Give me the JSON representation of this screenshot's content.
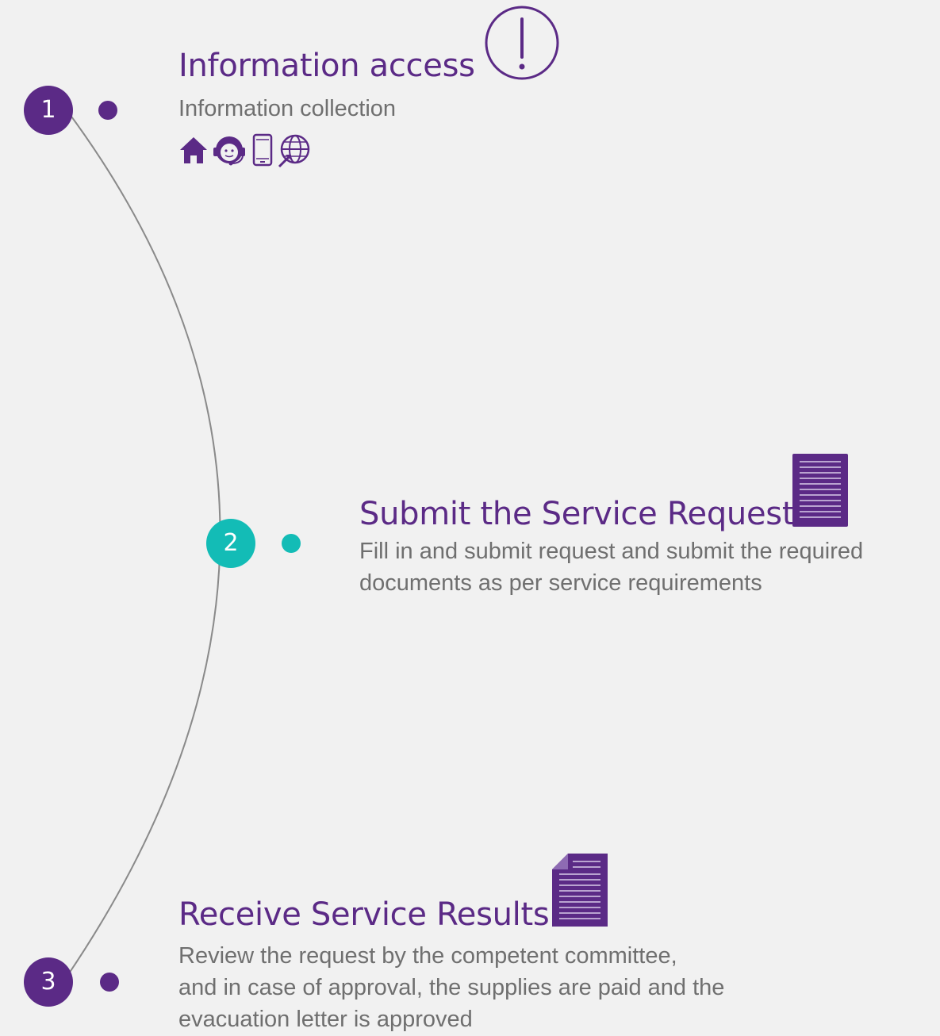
{
  "colors": {
    "accent": "#5b2a86",
    "teal": "#13bcb6",
    "text_gray": "#6f6f6f",
    "line": "#8a8a8a",
    "background": "#f1f1f1"
  },
  "steps": [
    {
      "number": "1",
      "title": "Information access",
      "description": [
        "Information collection"
      ],
      "title_icon": "exclamation-circle-icon",
      "channel_icons": [
        "home-icon",
        "call-center-agent-icon",
        "mobile-phone-icon",
        "globe-website-icon"
      ]
    },
    {
      "number": "2",
      "title": "Submit the Service Request",
      "description": [
        "Fill in and submit request and submit the required",
        "documents as per service requirements"
      ],
      "title_icon": "document-icon"
    },
    {
      "number": "3",
      "title": "Receive Service Results",
      "description": [
        "Review the request by the competent committee,",
        "and in case of approval, the supplies are paid and the",
        "evacuation letter is approved"
      ],
      "title_icon": "document-folded-icon"
    }
  ]
}
